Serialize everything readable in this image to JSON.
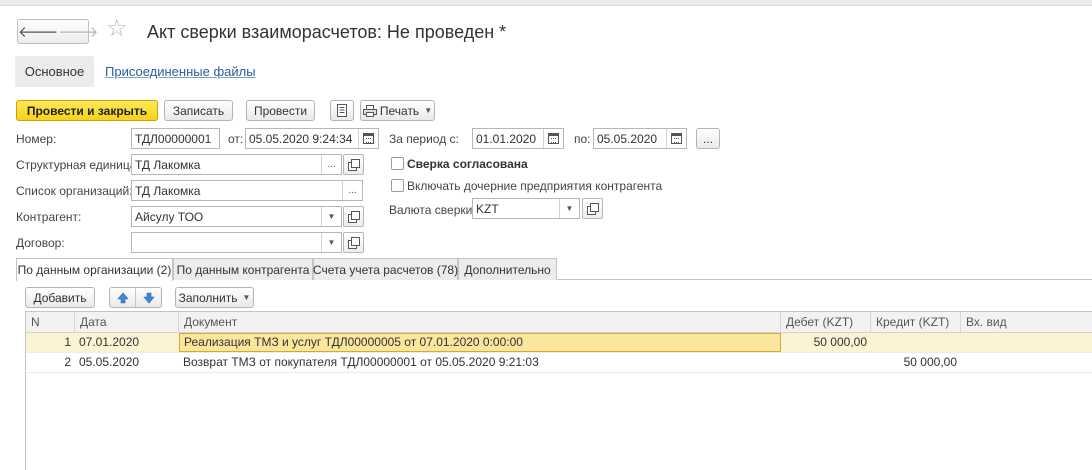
{
  "header": {
    "title": "Акт сверки взаиморасчетов: Не проведен *",
    "back_glyph": "🡐",
    "forward_glyph": "🡒",
    "star_glyph": "☆"
  },
  "subnav": {
    "main": "Основное",
    "attached": "Присоединенные файлы"
  },
  "toolbar": {
    "post_close": "Провести и закрыть",
    "save": "Записать",
    "post": "Провести",
    "print": "Печать"
  },
  "form": {
    "number_label": "Номер:",
    "number_value": "ТДЛ00000001",
    "date_label": "от:",
    "date_value": "05.05.2020  9:24:34",
    "unit_label": "Структурная единица:",
    "unit_value": "ТД Лакомка",
    "orgs_label": "Список организаций:",
    "orgs_value": "ТД Лакомка",
    "counterparty_label": "Контрагент:",
    "counterparty_value": "Айсулу ТОО",
    "contract_label": "Договор:",
    "contract_value": "",
    "period_label": "За период с:",
    "period_from": "01.01.2020",
    "period_to_label": "по:",
    "period_to": "05.05.2020",
    "agreed_label": "Сверка согласована",
    "subsidiaries_label": "Включать дочерние предприятия контрагента",
    "currency_label": "Валюта сверки:",
    "currency_value": "KZT",
    "ellipsis": "..."
  },
  "tabs": [
    {
      "label": "По данным организации (2)"
    },
    {
      "label": "По данным контрагента"
    },
    {
      "label": "Счета учета расчетов (78)"
    },
    {
      "label": "Дополнительно"
    }
  ],
  "table_toolbar": {
    "add": "Добавить",
    "fill": "Заполнить"
  },
  "table": {
    "columns": [
      "N",
      "Дата",
      "Документ",
      "Дебет (KZT)",
      "Кредит (KZT)",
      "Вх. вид"
    ],
    "rows": [
      {
        "n": "1",
        "date": "07.01.2020",
        "document": "Реализация ТМЗ и услуг ТДЛ00000005 от 07.01.2020 0:00:00",
        "debit": "50 000,00",
        "credit": "",
        "in_type": ""
      },
      {
        "n": "2",
        "date": "05.05.2020",
        "document": "Возврат ТМЗ от покупателя ТДЛ00000001 от 05.05.2020 9:21:03",
        "debit": "",
        "credit": "50 000,00",
        "in_type": ""
      }
    ]
  },
  "colors": {
    "accent_yellow": "#f7d21a",
    "link_blue": "#2a5e9c",
    "selected_row": "#fbf3d4",
    "arrow_blue": "#3d86d8"
  }
}
